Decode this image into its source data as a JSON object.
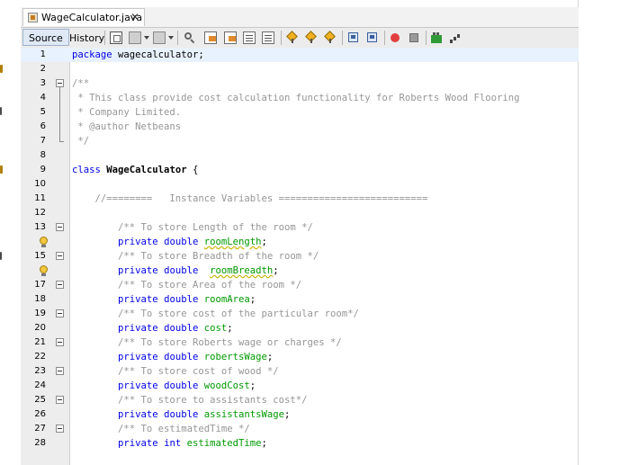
{
  "tab": {
    "filename": "WageCalculator.java",
    "close": "✕"
  },
  "toolbar": {
    "source_label": "Source",
    "history_label": "History"
  },
  "code": {
    "package_kw": "package",
    "package_name": " wagecalculator;",
    "doc_open": "/**",
    "doc_line1": " * This class provide cost calculation functionality for Roberts Wood Flooring",
    "doc_line2": " * Company Limited.",
    "doc_line3": " * @author Netbeans",
    "doc_close": " */",
    "class_kw": "class",
    "class_name": "WageCalculator",
    "class_brace": " {",
    "instance_vars_comment": "//========   Instance Variables ==========================",
    "private_kw": "private",
    "double_kw": "double",
    "int_kw": "int",
    "fields": [
      {
        "comment": "/** To store Length of the room */",
        "type": "double",
        "name": "roomLength",
        "spacer": " "
      },
      {
        "comment": "/** To store Breadth of the room */",
        "type": "double",
        "name": "roomBreadth",
        "spacer": "  "
      },
      {
        "comment": "/** To store Area of the room */",
        "type": "double",
        "name": "roomArea",
        "spacer": " "
      },
      {
        "comment": "/** To store cost of the particular room*/",
        "type": "double",
        "name": "cost",
        "spacer": " "
      },
      {
        "comment": "/** To store Roberts wage or charges */",
        "type": "double",
        "name": "robertsWage",
        "spacer": " "
      },
      {
        "comment": "/** To store cost of wood */",
        "type": "double",
        "name": "woodCost",
        "spacer": " "
      },
      {
        "comment": "/** To store to assistants cost*/",
        "type": "double",
        "name": "assistantsWage",
        "spacer": " "
      },
      {
        "comment": "/** To estimatedTime */",
        "type": "int",
        "name": "estimatedTime",
        "spacer": " "
      }
    ],
    "semicolon": ";"
  },
  "line_numbers": [
    "1",
    "2",
    "3",
    "4",
    "5",
    "6",
    "7",
    "8",
    "9",
    "10",
    "11",
    "12",
    "13",
    "",
    "15",
    "",
    "17",
    "18",
    "19",
    "20",
    "21",
    "22",
    "23",
    "24",
    "25",
    "26",
    "27",
    "28"
  ]
}
